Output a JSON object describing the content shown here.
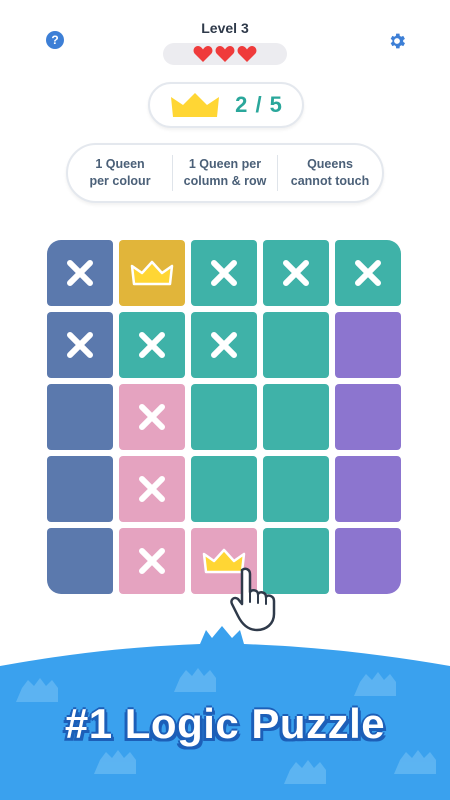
{
  "header": {
    "level_title": "Level 3",
    "lives": 3,
    "help_label": "?"
  },
  "score": {
    "text": "2 / 5",
    "icon": "crown-icon"
  },
  "rules": [
    {
      "line1": "1 Queen",
      "line2": "per colour"
    },
    {
      "line1": "1 Queen per",
      "line2": "column & row"
    },
    {
      "line1": "Queens",
      "line2": "cannot touch"
    }
  ],
  "colors": {
    "blue": "#5b79ad",
    "gold": "#e1b53a",
    "teal": "#3fb2a8",
    "purple": "#8c75cf",
    "pink": "#e5a3c0",
    "accent_blue": "#3d7fd6",
    "score_green": "#2aa79b",
    "crown_yellow": "#ffd634"
  },
  "board": {
    "size": 5,
    "cells": [
      [
        {
          "color": "blue",
          "mark": "x"
        },
        {
          "color": "gold",
          "mark": "crown"
        },
        {
          "color": "teal",
          "mark": "x"
        },
        {
          "color": "teal",
          "mark": "x"
        },
        {
          "color": "teal",
          "mark": "x"
        }
      ],
      [
        {
          "color": "blue",
          "mark": "x"
        },
        {
          "color": "teal",
          "mark": "x"
        },
        {
          "color": "teal",
          "mark": "x"
        },
        {
          "color": "teal",
          "mark": ""
        },
        {
          "color": "purple",
          "mark": ""
        }
      ],
      [
        {
          "color": "blue",
          "mark": ""
        },
        {
          "color": "pink",
          "mark": "x"
        },
        {
          "color": "teal",
          "mark": ""
        },
        {
          "color": "teal",
          "mark": ""
        },
        {
          "color": "purple",
          "mark": ""
        }
      ],
      [
        {
          "color": "blue",
          "mark": ""
        },
        {
          "color": "pink",
          "mark": "x"
        },
        {
          "color": "teal",
          "mark": ""
        },
        {
          "color": "teal",
          "mark": ""
        },
        {
          "color": "purple",
          "mark": ""
        }
      ],
      [
        {
          "color": "blue",
          "mark": ""
        },
        {
          "color": "pink",
          "mark": "x"
        },
        {
          "color": "pink",
          "mark": "crown"
        },
        {
          "color": "teal",
          "mark": ""
        },
        {
          "color": "purple",
          "mark": ""
        }
      ]
    ]
  },
  "banner": {
    "title": "#1 Logic Puzzle"
  }
}
